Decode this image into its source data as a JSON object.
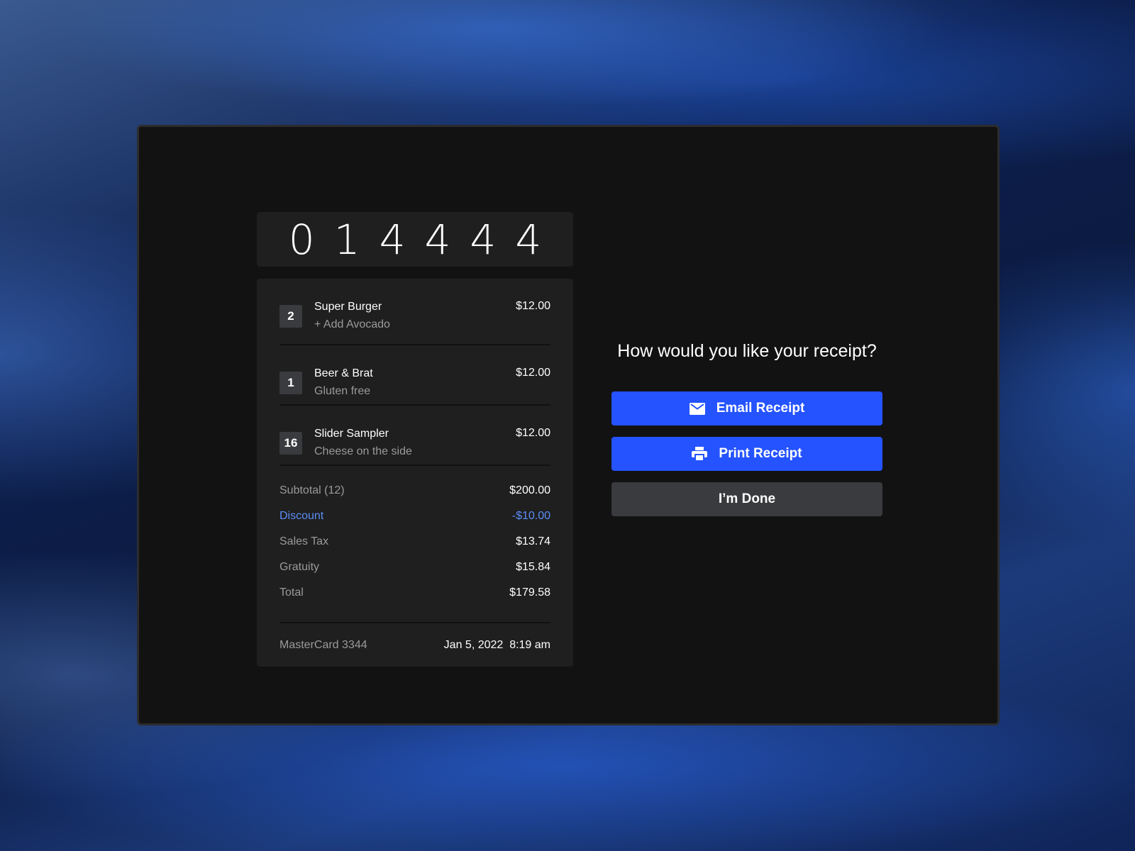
{
  "order_number": [
    "0",
    "1",
    "4",
    "4",
    "4",
    "4"
  ],
  "items": [
    {
      "qty": "2",
      "name": "Super Burger",
      "note": "+ Add Avocado",
      "price": "$12.00"
    },
    {
      "qty": "1",
      "name": "Beer & Brat",
      "note": "Gluten free",
      "price": "$12.00"
    },
    {
      "qty": "16",
      "name": "Slider Sampler",
      "note": "Cheese on the side",
      "price": "$12.00"
    }
  ],
  "summary": {
    "subtotal": {
      "label": "Subtotal (12)",
      "value": "$200.00"
    },
    "discount": {
      "label": "Discount",
      "value": "-$10.00"
    },
    "tax": {
      "label": "Sales Tax",
      "value": "$13.74"
    },
    "gratuity": {
      "label": "Gratuity",
      "value": "$15.84"
    },
    "total": {
      "label": "Total",
      "value": "$179.58"
    }
  },
  "payment": {
    "card": "MasterCard 3344",
    "datetime": "Jan 5, 2022  8:19 am"
  },
  "prompt": "How would you like your receipt?",
  "buttons": {
    "email": "Email Receipt",
    "print": "Print Receipt",
    "done": "I’m Done"
  },
  "icons": {
    "email": "envelope-icon",
    "print": "printer-icon"
  },
  "colors": {
    "accent": "#2453ff",
    "discount": "#5b8df7",
    "secondary_button": "#3a3b3e"
  }
}
